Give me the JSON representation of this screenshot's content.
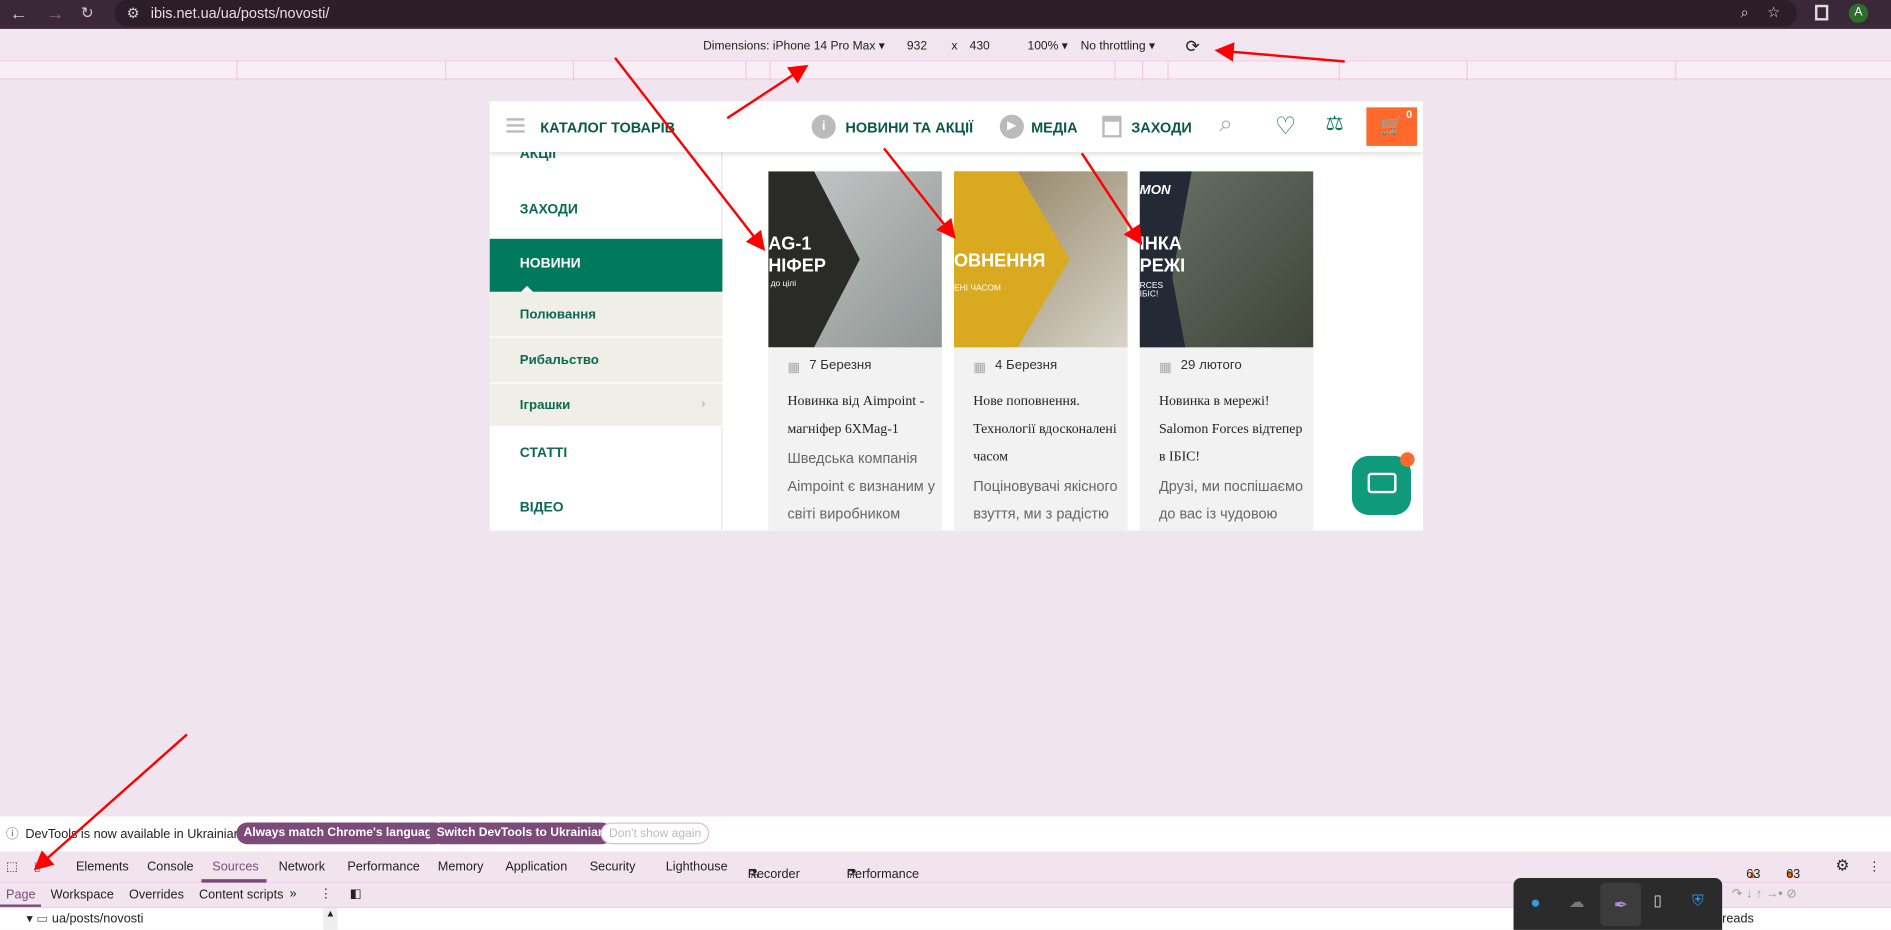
{
  "browser": {
    "url": "ibis.net.ua/ua/posts/novosti/",
    "profile_initial": "A"
  },
  "device_toolbar": {
    "dimensions_label": "Dimensions: iPhone 14 Pro Max",
    "width": "932",
    "x": "x",
    "height": "430",
    "zoom": "100%",
    "throttling": "No throttling"
  },
  "site": {
    "header": {
      "catalog": "КАТАЛОГ ТОВАРІВ",
      "news": "НОВИНИ ТА АКЦІЇ",
      "media": "МЕДІА",
      "events": "ЗАХОДИ",
      "cart_count": "0"
    },
    "sidebar": [
      {
        "label": "АКЦІЇ"
      },
      {
        "label": "ЗАХОДИ"
      },
      {
        "label": "НОВИНИ"
      },
      {
        "label": "Полювання"
      },
      {
        "label": "Рибальство"
      },
      {
        "label": "Іграшки"
      },
      {
        "label": "СТАТТІ"
      },
      {
        "label": "ВІДЕО"
      }
    ],
    "cards": [
      {
        "date": "7 Березня",
        "title": "Новинка від Aimpoint - магніфер 6XMag-1",
        "desc": "Шведська компанія Aimpoint є визнаним у світі виробником",
        "img_text": "AG-1 НІФЕР",
        "img_sub": "до цілі",
        "color": "#2a2a26"
      },
      {
        "date": "4 Березня",
        "title": "Нове поповнення. Технології вдосконалені часом",
        "desc": "Поціновувачі якісного взуття, ми з радістю",
        "img_text": "ОВНЕННЯ",
        "img_sub": "ЕНІ ЧАСОМ",
        "color": "#d9a920"
      },
      {
        "date": "29 лютого",
        "title": "Новинка в мережі! Salomon Forces відтепер в ІБІС!",
        "desc": "Друзі, ми поспішаємо до вас із чудовою",
        "img_text": "ІНКА РЕЖІ",
        "img_sub": "RCES ІБІС!",
        "img_brand": "MON",
        "color": "#232a35"
      }
    ],
    "colors": {
      "brand_green": "#00795c",
      "cart_orange": "#ff6a2c",
      "chat_teal": "#0f9a7c"
    }
  },
  "devtools": {
    "banner": {
      "text": "DevTools is now available in Ukrainian!",
      "btn1": "Always match Chrome's language",
      "btn2": "Switch DevTools to Ukrainian",
      "btn3": "Don't show again"
    },
    "tabs": [
      "Elements",
      "Console",
      "Sources",
      "Network",
      "Performance",
      "Memory",
      "Application",
      "Security",
      "Lighthouse",
      "Recorder",
      "Performance insights"
    ],
    "active_tab": "Sources",
    "warnings": "63",
    "issues": "63",
    "subtabs": [
      "Page",
      "Workspace",
      "Overrides",
      "Content scripts"
    ],
    "tree_item": "ua/posts/novosti",
    "threads": "reads"
  }
}
